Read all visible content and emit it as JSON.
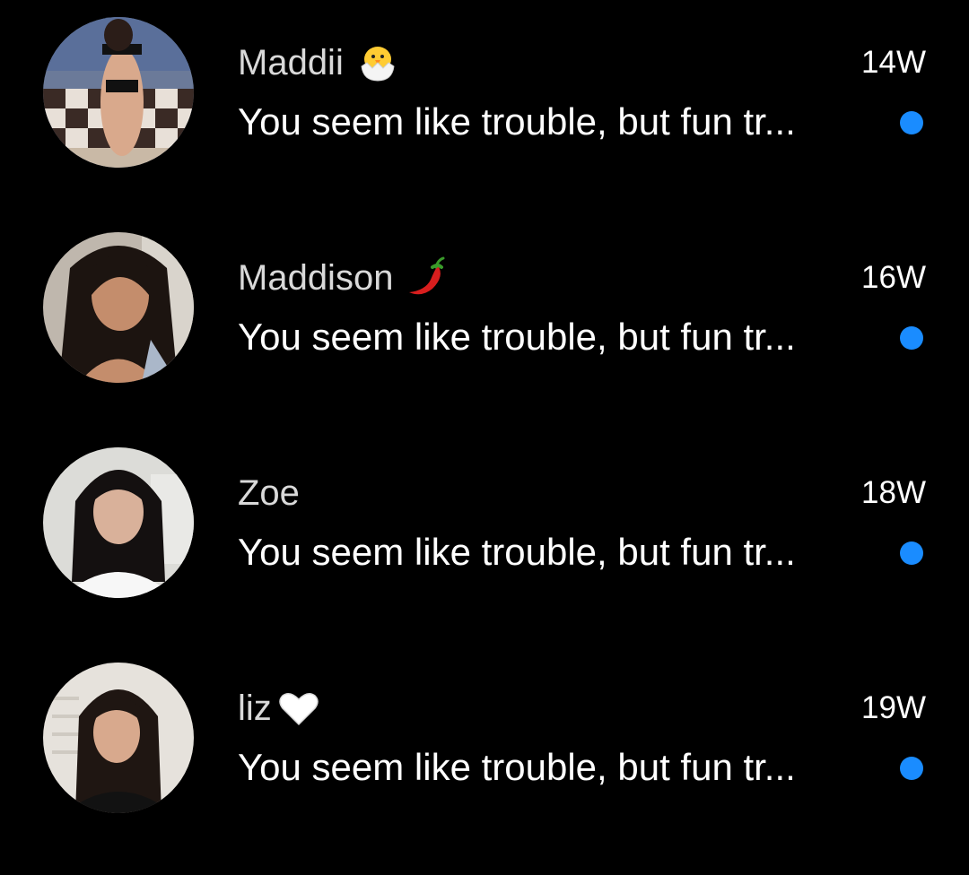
{
  "accent_unread": "#1a8cff",
  "threads": [
    {
      "name": "Maddii",
      "name_emoji": "hatching-chick-icon",
      "time": "14W",
      "preview": "You seem like trouble, but fun tr...",
      "unread": true
    },
    {
      "name": "Maddison",
      "name_emoji": "hot-pepper-icon",
      "time": "16W",
      "preview": "You seem like trouble, but fun tr...",
      "unread": true
    },
    {
      "name": "Zoe",
      "name_emoji": "",
      "time": "18W",
      "preview": "You seem like trouble, but fun tr...",
      "unread": true
    },
    {
      "name": "liz",
      "name_emoji": "white-heart-icon",
      "time": "19W",
      "preview": "You seem like trouble, but fun tr...",
      "unread": true
    }
  ]
}
